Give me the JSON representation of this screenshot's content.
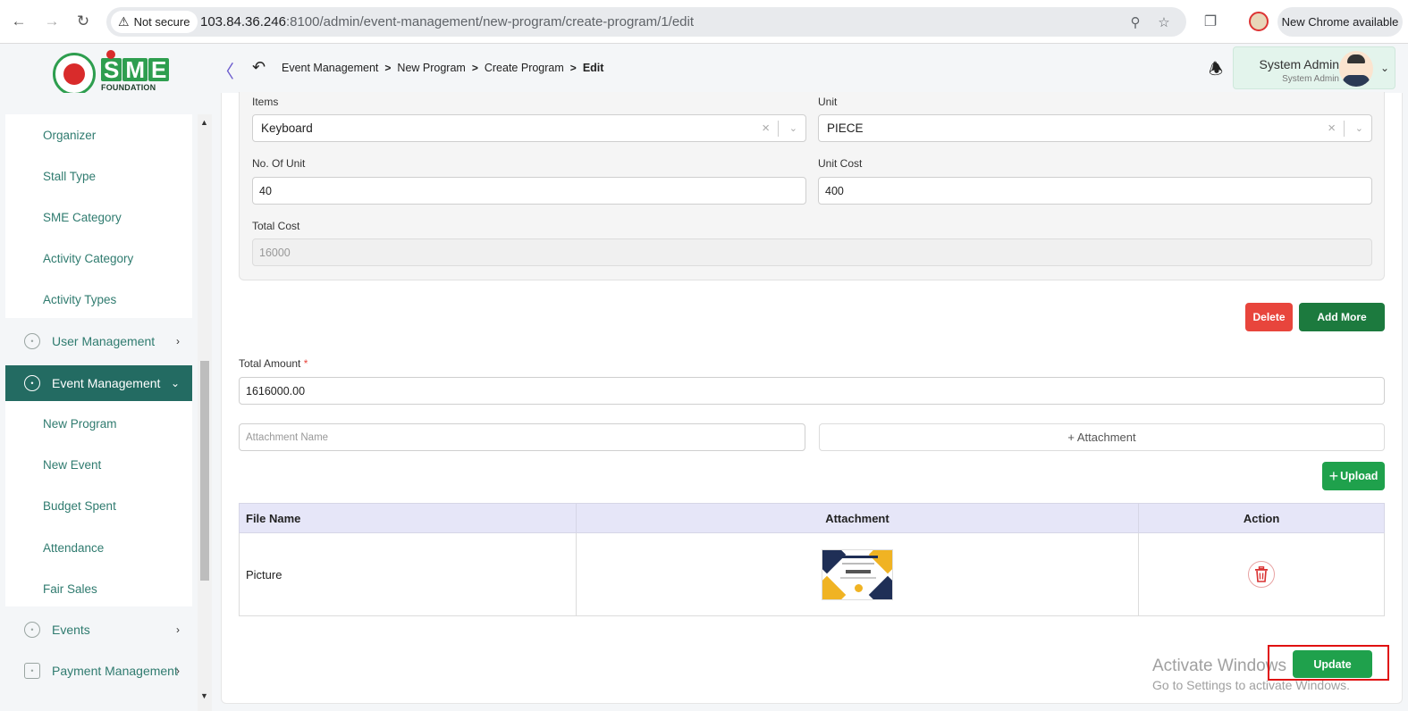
{
  "browser": {
    "security_label": "Not secure",
    "url_host": "103.84.36.246",
    "url_path": ":8100/admin/event-management/new-program/create-program/1/edit",
    "new_chrome_label": "New Chrome available"
  },
  "logo": {
    "letters": [
      "S",
      "M",
      "E"
    ],
    "subtitle": "FOUNDATION"
  },
  "breadcrumb": [
    "Event Management",
    "New Program",
    "Create Program",
    "Edit"
  ],
  "user": {
    "name": "System Admin",
    "role": "System Admin"
  },
  "sidebar": {
    "top_submenu": [
      "Organizer",
      "Stall Type",
      "SME Category",
      "Activity Category",
      "Activity Types"
    ],
    "user_management": "User Management",
    "event_management": "Event Management",
    "event_submenu": [
      "New Program",
      "New Event",
      "Budget Spent",
      "Attendance",
      "Fair Sales"
    ],
    "events": "Events",
    "payment_management": "Payment Management"
  },
  "item_form": {
    "items_label": "Items",
    "items_value": "Keyboard",
    "unit_label": "Unit",
    "unit_value": "PIECE",
    "no_of_unit_label": "No. Of Unit",
    "no_of_unit_value": "40",
    "unit_cost_label": "Unit Cost",
    "unit_cost_value": "400",
    "total_cost_label": "Total Cost",
    "total_cost_value": "16000"
  },
  "buttons": {
    "delete": "Delete",
    "add_more": "Add More",
    "attachment": "+ Attachment",
    "upload": "Upload",
    "update": "Update"
  },
  "total_amount": {
    "label": "Total Amount",
    "required_mark": "*",
    "value": "1616000.00"
  },
  "attachment_name_placeholder": "Attachment Name",
  "files_table": {
    "headers": [
      "File Name",
      "Attachment",
      "Action"
    ],
    "rows": [
      {
        "file_name": "Picture"
      }
    ]
  },
  "watermark": {
    "line1": "Activate Windows",
    "line2": "Go to Settings to activate Windows."
  },
  "colors": {
    "sidebar_active": "#236b62",
    "sidebar_text": "#2f7b6f",
    "primary_green": "#1fa14c",
    "delete_red": "#e8453c",
    "table_header": "#e6e6f8"
  }
}
